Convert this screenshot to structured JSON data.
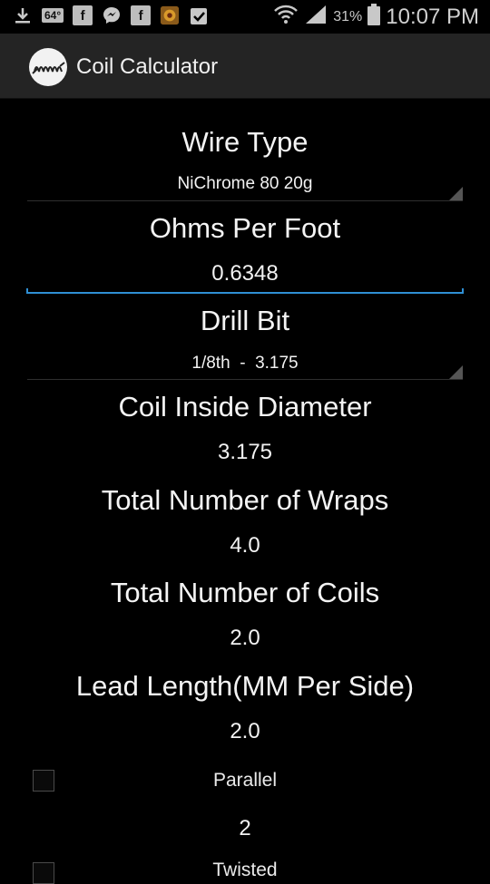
{
  "status_bar": {
    "badge_64": "64°",
    "battery_pct": "31%",
    "time": "10:07 PM",
    "icons": [
      "download-icon",
      "temperature-badge",
      "facebook-icon",
      "messenger-icon",
      "facebook-icon",
      "game-avatar-icon",
      "clipboard-check-icon",
      "wifi-icon",
      "signal-icon",
      "battery-icon"
    ]
  },
  "action_bar": {
    "title": "Coil Calculator",
    "icon": "coil-spring-icon"
  },
  "form": {
    "wire_type": {
      "label": "Wire Type",
      "value": "NiChrome 80 20g"
    },
    "ohms_per_foot": {
      "label": "Ohms Per Foot",
      "value": "0.6348"
    },
    "drill_bit": {
      "label": "Drill Bit",
      "value": "1/8th  -  3.175"
    },
    "coil_inside_diameter": {
      "label": "Coil Inside Diameter",
      "value": "3.175"
    },
    "total_wraps": {
      "label": "Total Number of Wraps",
      "value": "4.0"
    },
    "total_coils": {
      "label": "Total Number of Coils",
      "value": "2.0"
    },
    "lead_length": {
      "label": "Lead Length(MM Per Side)",
      "value": "2.0"
    },
    "parallel": {
      "label": "Parallel",
      "checked": false,
      "value": "2"
    },
    "twisted": {
      "label": "Twisted",
      "checked": false
    }
  },
  "colors": {
    "accent": "#2f8fd4",
    "background": "#000000",
    "actionbar": "#242424"
  }
}
